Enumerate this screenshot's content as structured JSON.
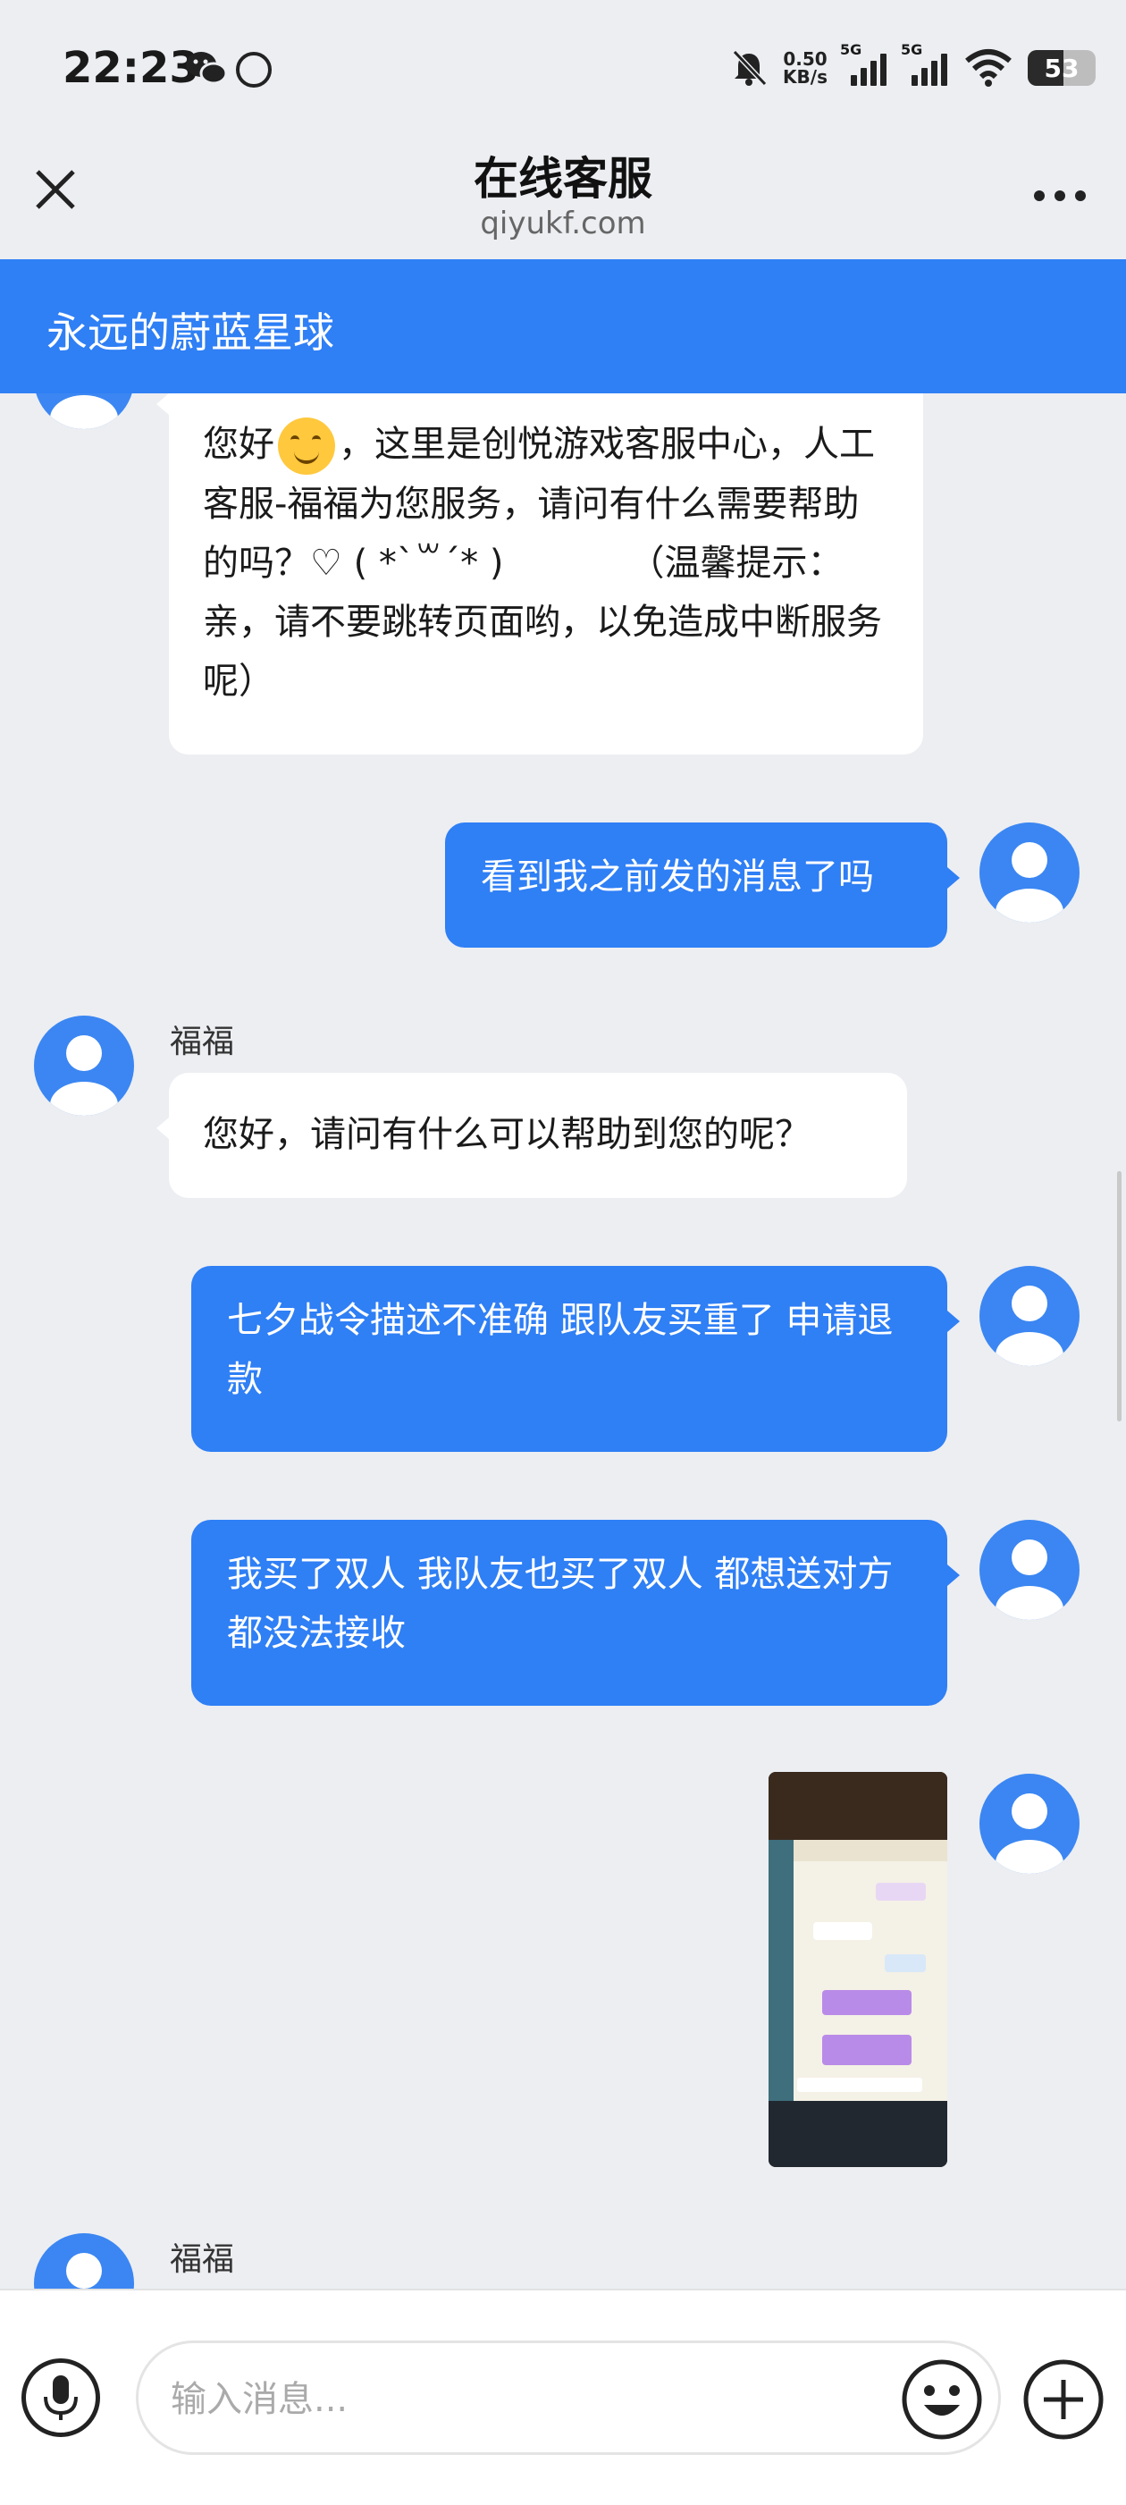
{
  "status_bar": {
    "time": "22:23",
    "net_speed_value": "0.50",
    "net_speed_unit": "KB/s",
    "signal1_label": "5G",
    "signal2_label": "5G",
    "battery": "53",
    "icons": [
      "wechat-icon",
      "app-icon",
      "mute-icon",
      "signal-icon",
      "wifi-icon",
      "battery-icon"
    ]
  },
  "title_bar": {
    "title": "在线客服",
    "domain": "qiyukf.com"
  },
  "chat_header": {
    "name": "永远的蔚蓝星球"
  },
  "messages": [
    {
      "from": "agent",
      "text_before": "您好",
      "text_after": "，这里是创悦游戏客服中心，人工客服-福福为您服务，请问有什么需要帮助的吗？♡ ( *ˋ꒳ˊ* )　　　　（温馨提示：亲，请不要跳转页面哟，以免造成中断服务呢）"
    },
    {
      "from": "user",
      "text": "看到我之前发的消息了吗"
    },
    {
      "from": "agent",
      "sender": "福福",
      "text": "您好，请问有什么可以帮助到您的呢？"
    },
    {
      "from": "user",
      "text": "七夕战令描述不准确 跟队友买重了 申请退款"
    },
    {
      "from": "user",
      "text": "我买了双人 我队友也买了双人 都想送对方 都没法接收"
    },
    {
      "from": "user",
      "type": "image"
    },
    {
      "from": "agent",
      "sender": "福福"
    }
  ],
  "input_bar": {
    "placeholder": "输入消息..."
  },
  "colors": {
    "brand_blue": "#2f7ff5",
    "background": "#eceef2",
    "bubble_in": "#ffffff"
  }
}
